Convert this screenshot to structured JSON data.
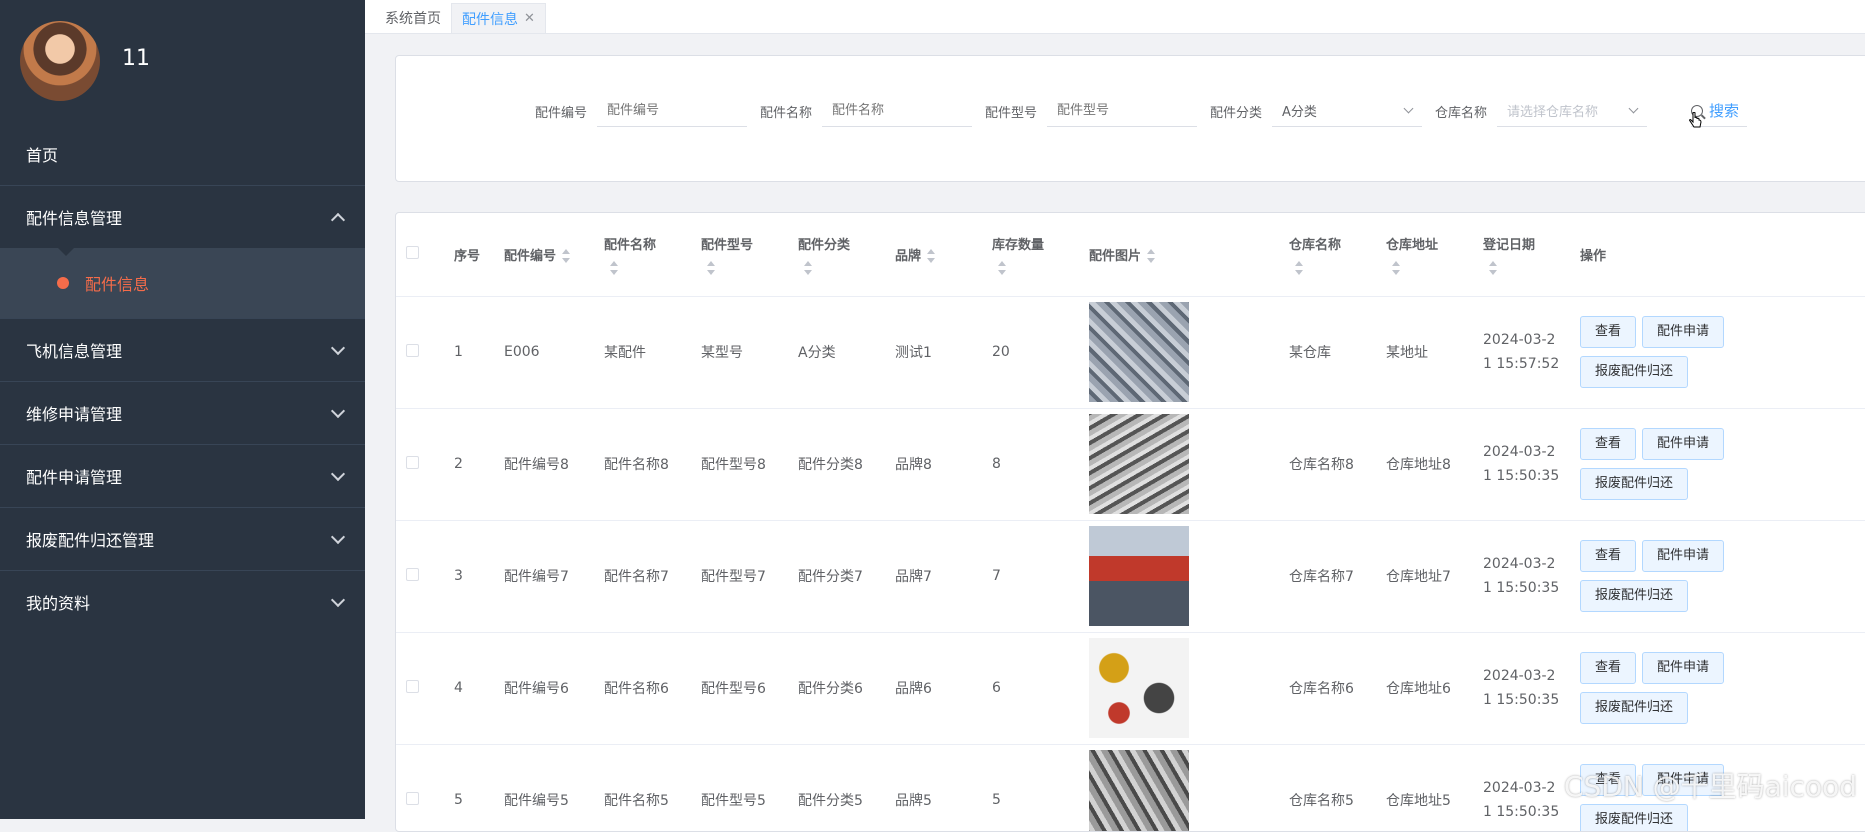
{
  "user": {
    "name": "11"
  },
  "menu": {
    "home": "首页",
    "groups": [
      {
        "label": "配件信息管理",
        "expanded": true,
        "items": [
          {
            "label": "配件信息",
            "active": true
          }
        ]
      },
      {
        "label": "飞机信息管理",
        "expanded": false
      },
      {
        "label": "维修申请管理",
        "expanded": false
      },
      {
        "label": "配件申请管理",
        "expanded": false
      },
      {
        "label": "报废配件归还管理",
        "expanded": false
      },
      {
        "label": "我的资料",
        "expanded": false
      }
    ]
  },
  "tabs": [
    {
      "label": "系统首页"
    },
    {
      "label": "配件信息",
      "active": true,
      "closable": true
    }
  ],
  "search": {
    "fields": [
      {
        "label": "配件编号",
        "placeholder": "配件编号"
      },
      {
        "label": "配件名称",
        "placeholder": "配件名称"
      },
      {
        "label": "配件型号",
        "placeholder": "配件型号"
      },
      {
        "label": "配件分类",
        "value": "A分类"
      },
      {
        "label": "仓库名称",
        "placeholder": "请选择仓库名称"
      }
    ],
    "button": "搜索"
  },
  "table": {
    "columns": [
      "序号",
      "配件编号",
      "配件名称",
      "配件型号",
      "配件分类",
      "品牌",
      "库存数量",
      "配件图片",
      "仓库名称",
      "仓库地址",
      "登记日期",
      "操作"
    ],
    "actions": {
      "view": "查看",
      "apply": "配件申请",
      "return": "报废配件归还"
    },
    "rows": [
      {
        "index": "1",
        "code": "E006",
        "name": "某配件",
        "model": "某型号",
        "category": "A分类",
        "brand": "测试1",
        "stock": "20",
        "image": "parts-photo-1",
        "warehouse": "某仓库",
        "address": "某地址",
        "date": "2024-03-21 15:57:52"
      },
      {
        "index": "2",
        "code": "配件编号8",
        "name": "配件名称8",
        "model": "配件型号8",
        "category": "配件分类8",
        "brand": "品牌8",
        "stock": "8",
        "image": "parts-photo-2",
        "warehouse": "仓库名称8",
        "address": "仓库地址8",
        "date": "2024-03-21 15:50:35"
      },
      {
        "index": "3",
        "code": "配件编号7",
        "name": "配件名称7",
        "model": "配件型号7",
        "category": "配件分类7",
        "brand": "品牌7",
        "stock": "7",
        "image": "parts-photo-3",
        "warehouse": "仓库名称7",
        "address": "仓库地址7",
        "date": "2024-03-21 15:50:35"
      },
      {
        "index": "4",
        "code": "配件编号6",
        "name": "配件名称6",
        "model": "配件型号6",
        "category": "配件分类6",
        "brand": "品牌6",
        "stock": "6",
        "image": "parts-photo-4",
        "warehouse": "仓库名称6",
        "address": "仓库地址6",
        "date": "2024-03-21 15:50:35"
      },
      {
        "index": "5",
        "code": "配件编号5",
        "name": "配件名称5",
        "model": "配件型号5",
        "category": "配件分类5",
        "brand": "品牌5",
        "stock": "5",
        "image": "parts-photo-5",
        "warehouse": "仓库名称5",
        "address": "仓库地址5",
        "date": "2024-03-21 15:50:35"
      }
    ]
  },
  "watermark": "CSDN @千里码aicood",
  "colors": {
    "sidebar": "#2a3441",
    "accent": "#409eff",
    "active_menu": "#f56c4a"
  }
}
